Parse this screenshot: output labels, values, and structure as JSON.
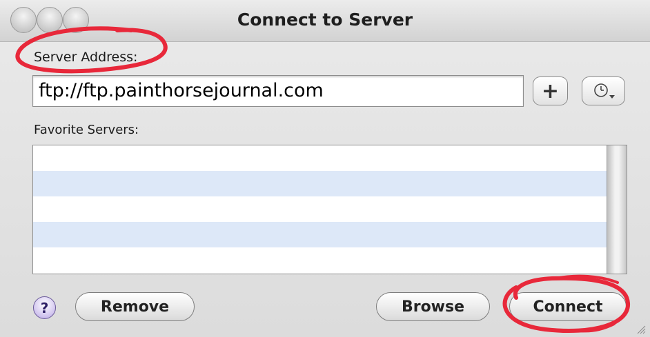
{
  "window": {
    "title": "Connect to Server"
  },
  "server": {
    "label": "Server Address:",
    "value": "ftp://ftp.painthorsejournal.com"
  },
  "toolbar": {
    "add_label": "+"
  },
  "favorites": {
    "label": "Favorite Servers:",
    "rows": [
      "",
      "",
      "",
      "",
      ""
    ]
  },
  "buttons": {
    "help_label": "?",
    "remove": "Remove",
    "browse": "Browse",
    "connect": "Connect"
  },
  "colors": {
    "annotation": "#e8283a",
    "list_alt_row": "#dde8f8"
  },
  "icons": [
    "traffic-light-close",
    "traffic-light-minimize",
    "traffic-light-zoom",
    "recent-servers-clock-icon",
    "help-icon",
    "resize-grip-icon"
  ]
}
